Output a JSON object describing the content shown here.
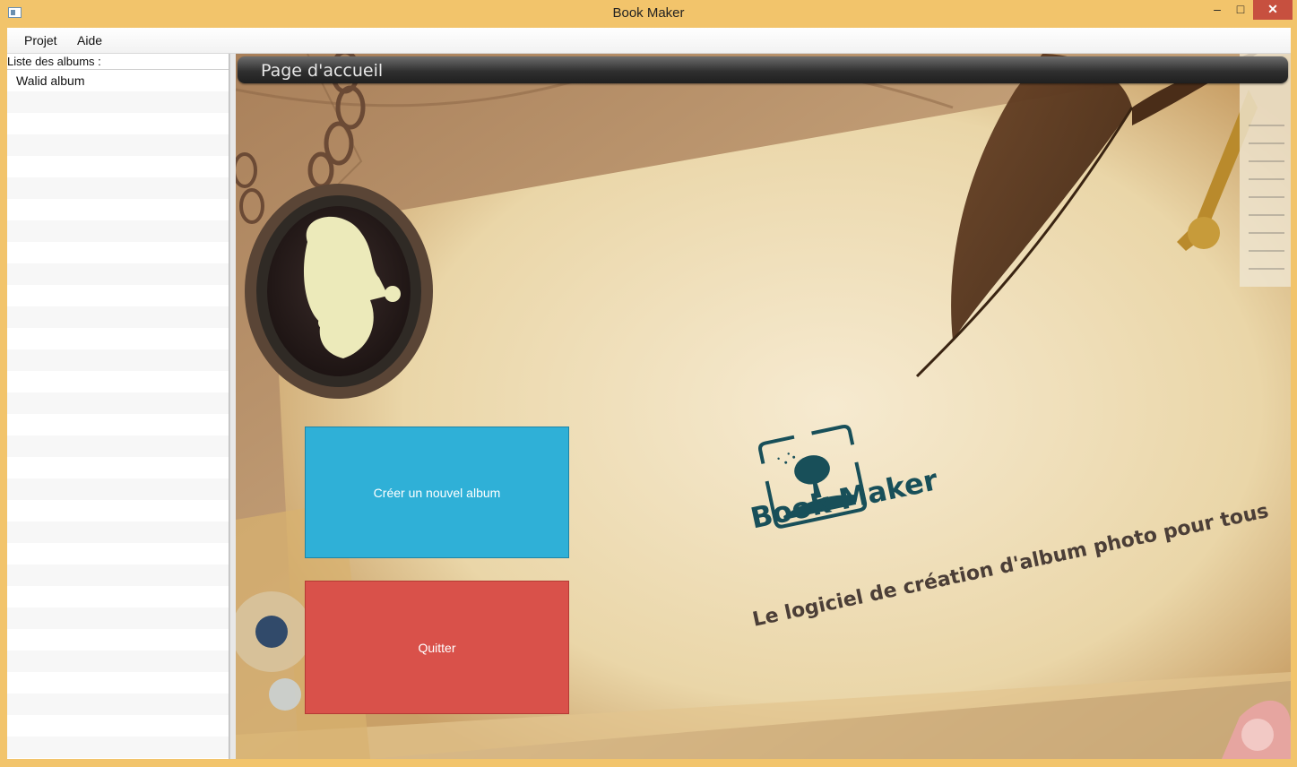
{
  "window": {
    "title": "Book Maker",
    "controls": {
      "minimize": "–",
      "maximize": "□",
      "close": "✕"
    }
  },
  "menu": {
    "items": [
      {
        "label": "Projet"
      },
      {
        "label": "Aide"
      }
    ]
  },
  "sidebar": {
    "header": "Liste des albums :",
    "albums": [
      {
        "label": "Walid album"
      }
    ]
  },
  "main": {
    "header_title": "Page d'accueil",
    "create_button": "Créer un nouvel album",
    "quit_button": "Quitter",
    "brand_name": "Book Maker",
    "tagline": "Le logiciel de création d'album photo pour tous"
  },
  "colors": {
    "create": "#2fb0d7",
    "quit": "#d9514a",
    "brand": "#184f59",
    "window_frame": "#f2c46b"
  }
}
